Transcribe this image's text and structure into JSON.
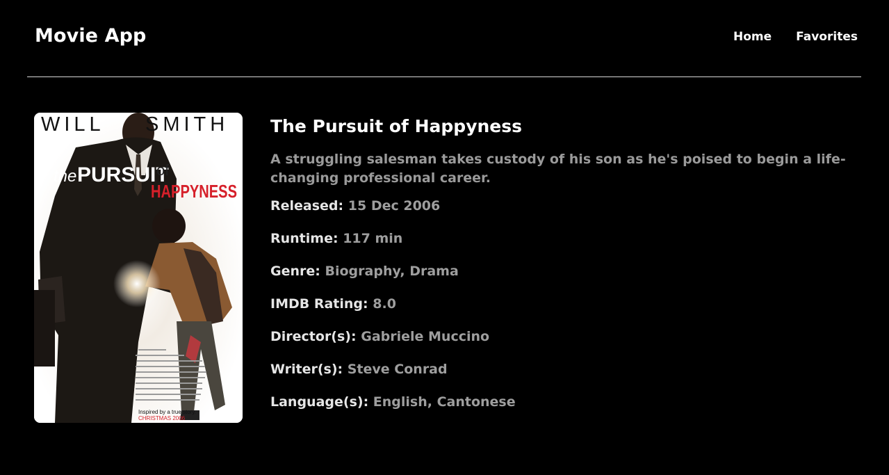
{
  "header": {
    "brand": "Movie App",
    "nav": [
      {
        "label": "Home"
      },
      {
        "label": "Favorites"
      }
    ]
  },
  "poster": {
    "top_left": "WILL",
    "top_right": "SMITH",
    "title_the": "the",
    "title_pursuit": "PURSUIT",
    "title_of": "of",
    "title_happyness": "HAPPYNESS",
    "tagline": "Inspired by a true story.",
    "release": "CHRISTMAS 2006"
  },
  "movie": {
    "title": "The Pursuit of Happyness",
    "plot": "A struggling salesman takes custody of his son as he's poised to begin a life-changing professional career.",
    "details": [
      {
        "label": "Released:",
        "value": "15 Dec 2006"
      },
      {
        "label": "Runtime:",
        "value": "117 min"
      },
      {
        "label": "Genre:",
        "value": "Biography, Drama"
      },
      {
        "label": "IMDB Rating:",
        "value": "8.0"
      },
      {
        "label": "Director(s):",
        "value": "Gabriele Muccino"
      },
      {
        "label": "Writer(s):",
        "value": "Steve Conrad"
      },
      {
        "label": "Language(s):",
        "value": "English, Cantonese"
      }
    ]
  },
  "colors": {
    "background": "#000000",
    "text": "#ffffff",
    "muted": "#9e9e9e",
    "poster_red": "#d6202a"
  }
}
